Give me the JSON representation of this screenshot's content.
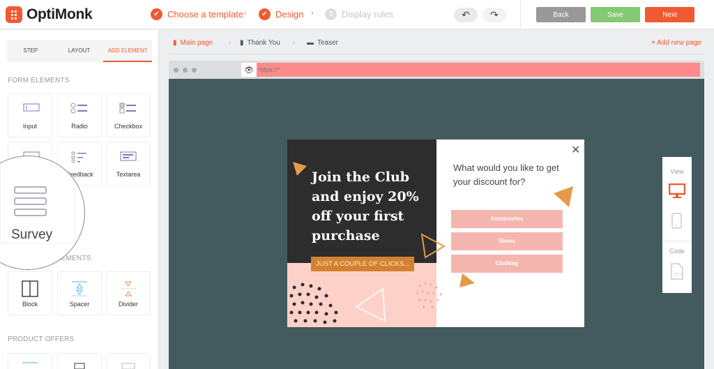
{
  "app": {
    "name": "OptiMonk"
  },
  "steps": [
    {
      "label": "Choose a template",
      "state": "done"
    },
    {
      "label": "Design",
      "state": "done"
    },
    {
      "label": "Display rules",
      "number": "3",
      "state": "inactive"
    }
  ],
  "header_buttons": {
    "back": "Back",
    "save": "Save",
    "next": "Next"
  },
  "colors": {
    "accent": "#ef5a32",
    "back": "#999999",
    "save": "#84c973",
    "next": "#ef5a32",
    "stage": "#435a5e"
  },
  "sidebar": {
    "tabs": [
      "STEP",
      "LAYOUT",
      "ADD ELEMENT"
    ],
    "active_tab": "ADD ELEMENT",
    "form_elements_heading": "FORM ELEMENTS",
    "form_elements": [
      "Input",
      "Radio",
      "Checkbox",
      "Survey",
      "Feedback",
      "Textarea"
    ],
    "magnified": "Survey",
    "layout_heading": "ELEMENTS",
    "layout_elements": [
      "Block",
      "Spacer",
      "Divider"
    ],
    "product_heading": "PRODUCT OFFERS"
  },
  "pages": {
    "tabs": [
      "Main page",
      "Thank You",
      "Teaser"
    ],
    "active": "Main page",
    "add": "+ Add new page"
  },
  "browser": {
    "url": "https://*"
  },
  "popup": {
    "headline": "Join the Club and enjoy 20% off your first purchase",
    "cta": "JUST A COUPLE OF CLICKS...",
    "question": "What would you like to get your discount for?",
    "options": [
      "Accessories",
      "Shoes",
      "Clothing"
    ]
  },
  "view_panel": {
    "view": "View",
    "code": "Code",
    "active": "desktop"
  }
}
